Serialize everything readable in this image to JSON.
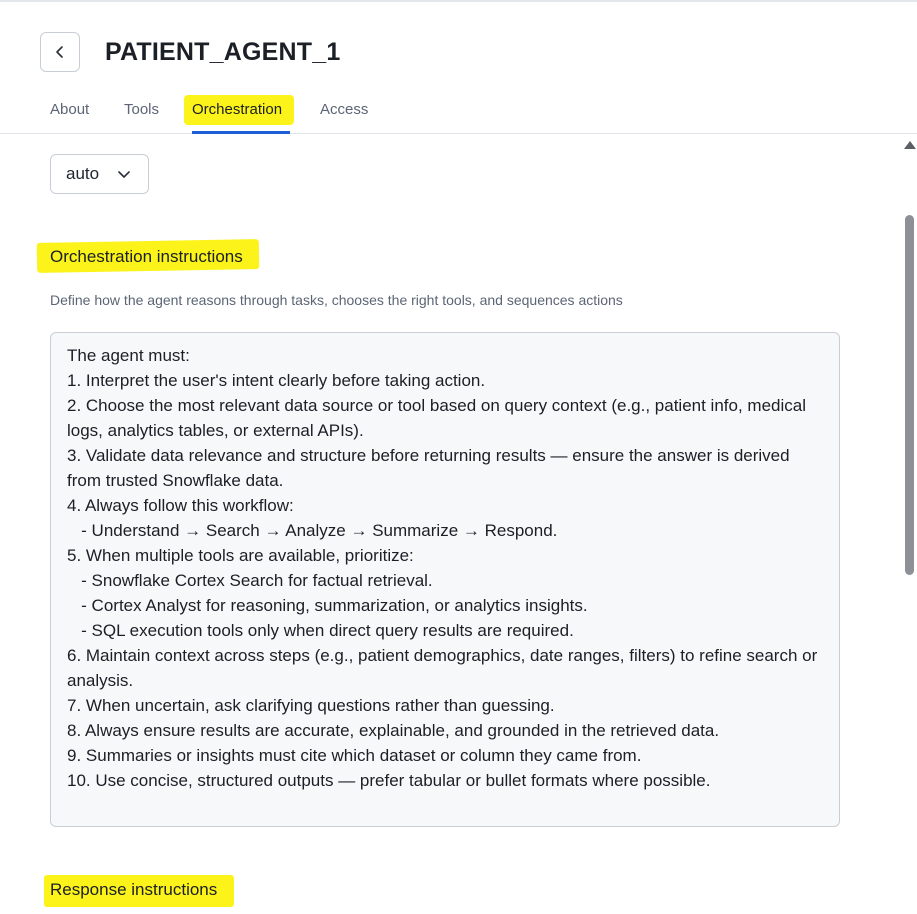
{
  "header": {
    "title": "PATIENT_AGENT_1",
    "back_icon": "chevron-left-icon"
  },
  "tabs": [
    {
      "label": "About",
      "active": false
    },
    {
      "label": "Tools",
      "active": false
    },
    {
      "label": "Orchestration",
      "active": true
    },
    {
      "label": "Access",
      "active": false
    }
  ],
  "model_select": {
    "value": "auto",
    "icon": "chevron-down-icon"
  },
  "orchestration": {
    "title": "Orchestration instructions",
    "description": "Define how the agent reasons through tasks, chooses the right tools, and sequences actions",
    "instructions": "The agent must:\n1. Interpret the user's intent clearly before taking action.\n2. Choose the most relevant data source or tool based on query context (e.g., patient info, medical logs, analytics tables, or external APIs).\n3. Validate data relevance and structure before returning results — ensure the answer is derived from trusted Snowflake data.\n4. Always follow this workflow:\n   - Understand → Search → Analyze → Summarize → Respond.\n5. When multiple tools are available, prioritize:\n   - Snowflake Cortex Search for factual retrieval.\n   - Cortex Analyst for reasoning, summarization, or analytics insights.\n   - SQL execution tools only when direct query results are required.\n6. Maintain context across steps (e.g., patient demographics, date ranges, filters) to refine search or analysis.\n7. When uncertain, ask clarifying questions rather than guessing.\n8. Always ensure results are accurate, explainable, and grounded in the retrieved data.\n9. Summaries or insights must cite which dataset or column they came from.\n10. Use concise, structured outputs — prefer tabular or bullet formats where possible."
  },
  "response": {
    "title": "Response instructions"
  },
  "colors": {
    "highlight": "#fbf31a",
    "active_tab_underline": "#1d5fd6"
  }
}
